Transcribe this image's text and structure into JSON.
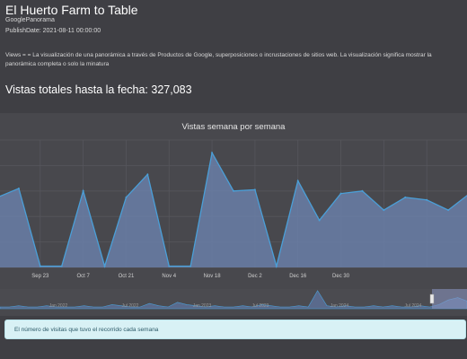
{
  "page": {
    "title": "El Huerto Farm to Table",
    "source": "GooglePanorama",
    "publish_date": "PublishDate: 2021-08-11 00:00:00",
    "description": "Views = = La visualización de una panorámica a través de Productos de Google, superposiciones o incrustaciones de sitios web. La visualización significa mostrar la panorámica completa o solo la minatura",
    "total_views": "Vistas totales hasta la fecha: 327,083",
    "info_note": "El número de visitas que tuvo el recorrido cada semana"
  },
  "colors": {
    "background": "#3f3f44",
    "chart_panel": "#48484d",
    "series_line": "#4a9fd8",
    "series_fill": "#6a7fa8",
    "note_bg": "#d8f1f5",
    "note_text": "#2c5a68"
  },
  "chart_data": {
    "type": "area",
    "title": "Vistas semana por semana",
    "x_tick_labels": [
      "Sep 23",
      "Oct 7",
      "Oct 21",
      "Nov 4",
      "Nov 18",
      "Dec 2",
      "Dec 16",
      "Dec 30"
    ],
    "series": [
      {
        "values": [
          55,
          62,
          1,
          1,
          60,
          1,
          55,
          73,
          1,
          1,
          90,
          60,
          61,
          1,
          68,
          37,
          58,
          60,
          45,
          55,
          53,
          45,
          58
        ]
      }
    ],
    "y_range": [
      0,
      100
    ],
    "grid": true,
    "navigator": {
      "labels": [
        "Jan 2022",
        "Jul 2022",
        "Jan 2023",
        "Jul 2023",
        "Jan 2024",
        "Jul 2024"
      ]
    }
  }
}
